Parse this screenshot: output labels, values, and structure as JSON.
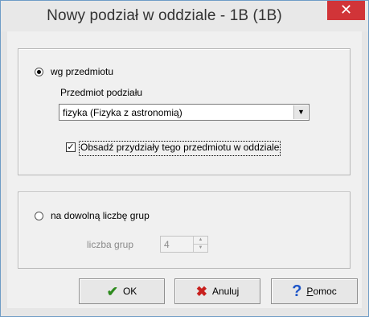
{
  "window": {
    "title": "Nowy podział w oddziale - 1B (1B)",
    "close_glyph": "✕"
  },
  "subject_group": {
    "radio_label": "wg przedmiotu",
    "subject_label": "Przedmiot podziału",
    "subject_value": "fizyka (Fizyka z astronomią)",
    "assign_checkbox_label": "Obsadź przydziały tego przedmiotu w oddziale",
    "assign_checked": true
  },
  "groups_group": {
    "radio_label": "na dowolną liczbę grup",
    "count_label": "liczba grup",
    "count_value": "4"
  },
  "buttons": {
    "ok_label": "OK",
    "cancel_label": "Anuluj",
    "help_label_first": "P",
    "help_label_rest": "omoc"
  },
  "icons": {
    "ok": "check-icon",
    "cancel": "x-icon",
    "help": "question-icon"
  },
  "colors": {
    "close_bg": "#d13438",
    "ok_icon": "#2e8b1e",
    "cancel_icon": "#c8201e",
    "help_icon": "#1d55c8"
  }
}
